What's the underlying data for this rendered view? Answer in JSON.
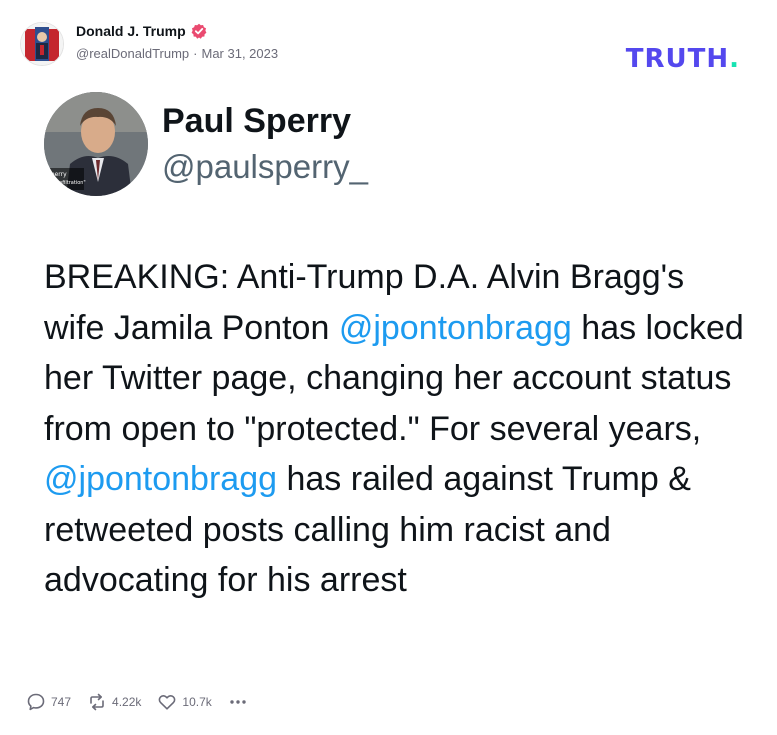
{
  "post": {
    "author_name": "Donald J. Trump",
    "author_handle": "@realDonaldTrump",
    "separator": "·",
    "date": "Mar 31, 2023"
  },
  "brand": {
    "logo_text": "TRUTH",
    "logo_dot": ".",
    "colors": {
      "logo": "#5448ee",
      "logo_dot": "#17e3b2",
      "verified": "#ea4a70",
      "mention": "#1d9bf0"
    }
  },
  "quoted_tweet": {
    "name": "Paul Sperry",
    "handle": "@paulsperry_",
    "avatar_caption_line1": "Sperry",
    "avatar_caption_line2": "or, \"Infiltration\"",
    "text": [
      {
        "text": "BREAKING: Anti-Trump D.A. Alvin Bragg's wife Jamila Ponton "
      },
      {
        "mention": "@jpontonbragg"
      },
      {
        "text": " has locked her Twitter page, changing her account status from open to \"protected.\" For several years, "
      },
      {
        "mention": "@jpontonbragg"
      },
      {
        "text": " has railed against Trump & retweeted posts calling him racist and advocating for his arrest"
      }
    ]
  },
  "actions": {
    "replies": "747",
    "retruths": "4.22k",
    "likes": "10.7k",
    "icons": [
      "reply-icon",
      "retruth-icon",
      "like-icon",
      "more-icon"
    ]
  }
}
